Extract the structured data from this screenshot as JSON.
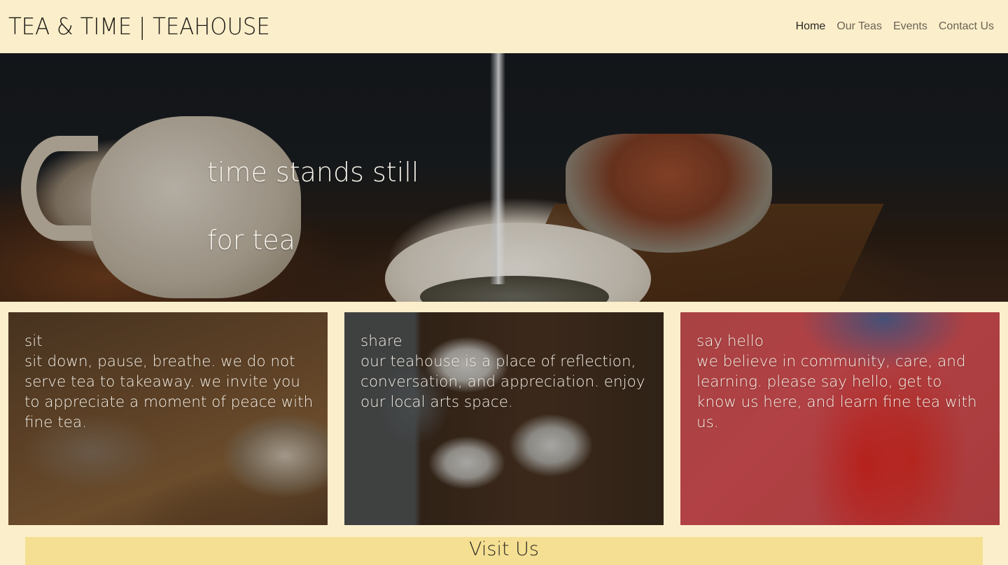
{
  "header": {
    "brand": "TEA & TIME | TEAHOUSE",
    "nav": [
      {
        "label": "Home",
        "active": true
      },
      {
        "label": "Our Teas",
        "active": false
      },
      {
        "label": "Events",
        "active": false
      },
      {
        "label": "Contact Us",
        "active": false
      }
    ]
  },
  "hero": {
    "line1": "time stands still",
    "line2": "for tea"
  },
  "cards": [
    {
      "title": "sit",
      "body": "sit down, pause, breathe. we do not serve tea to takeaway. we invite you to appreciate a moment of peace with fine tea."
    },
    {
      "title": "share",
      "body": "our teahouse is a place of reflection, conversation, and appreciation. enjoy our local arts space."
    },
    {
      "title": "say hello",
      "body": "we believe in community, care, and learning. please say hello, get to know us here, and learn fine tea with us."
    }
  ],
  "visit": {
    "heading": "Visit Us"
  },
  "colors": {
    "page_bg": "#fbefcb",
    "visit_bar": "#f5df92",
    "hero_text": "#f6f2ea"
  }
}
